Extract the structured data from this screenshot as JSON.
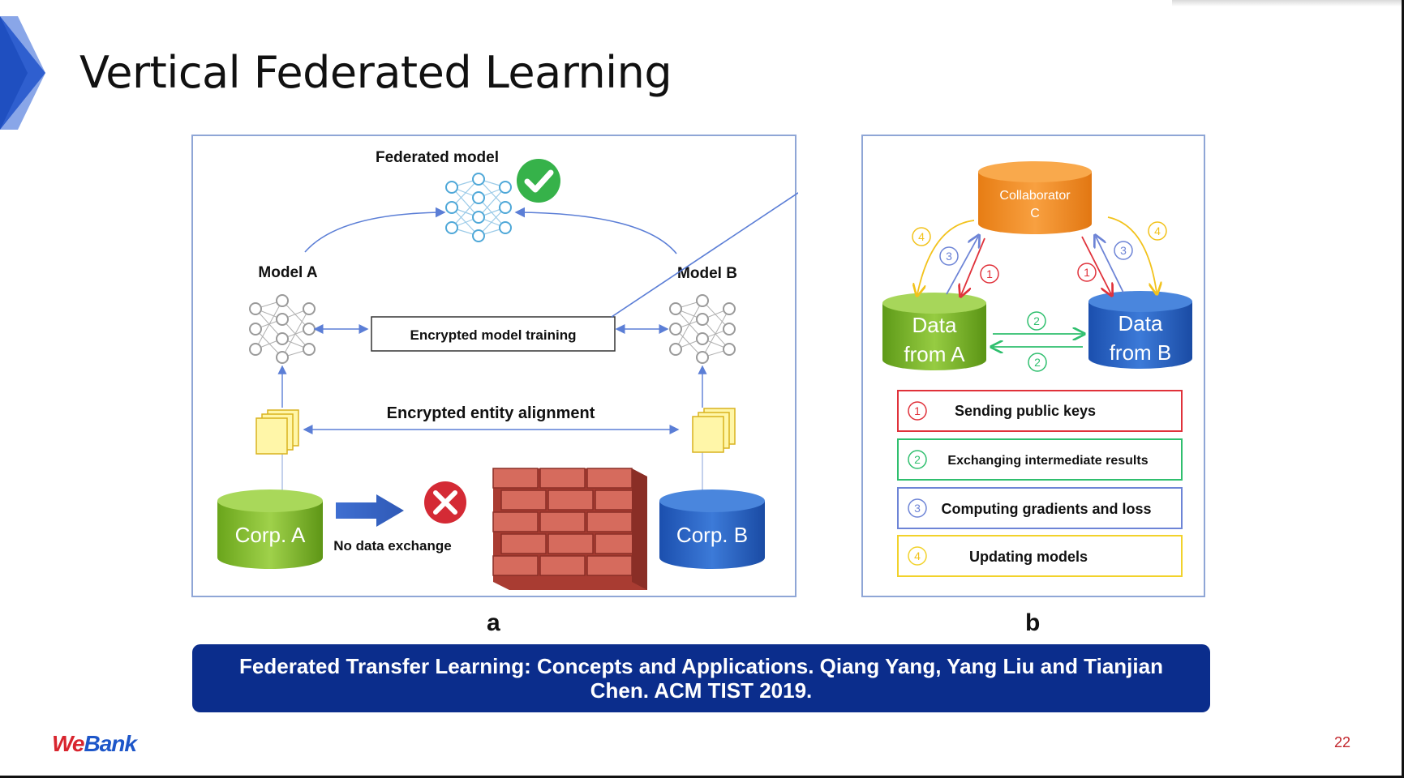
{
  "slide": {
    "title": "Vertical Federated Learning",
    "page_number": "22",
    "brand_prefix": "We",
    "brand_suffix": "Bank",
    "citation": "Federated Transfer Learning: Concepts and Applications.  Qiang Yang, Yang Liu and Tianjian Chen.  ACM TIST 2019."
  },
  "panel_a": {
    "letter": "a",
    "federated_model": "Federated model",
    "model_a": "Model A",
    "model_b": "Model B",
    "encrypted_training": "Encrypted model training",
    "encrypted_alignment": "Encrypted entity alignment",
    "corp_a": "Corp. A",
    "corp_b": "Corp. B",
    "no_data_exchange": "No data exchange"
  },
  "panel_b": {
    "letter": "b",
    "collaborator_line1": "Collaborator",
    "collaborator_line2": "C",
    "data_a_line1": "Data",
    "data_a_line2": "from A",
    "data_b_line1": "Data",
    "data_b_line2": "from B",
    "legend": [
      {
        "num": "1",
        "label": "Sending public keys",
        "color": "#e0313a"
      },
      {
        "num": "2",
        "label": "Exchanging intermediate results",
        "color": "#2fbf6e"
      },
      {
        "num": "3",
        "label": "Computing gradients and loss",
        "color": "#6d84d6"
      },
      {
        "num": "4",
        "label": "Updating models",
        "color": "#f2d22b"
      }
    ]
  },
  "colors": {
    "title_blue": "#0b2d8c",
    "chevron_blue": "#1f4fc0",
    "green": "#7dbb2a",
    "blue": "#2563c7",
    "orange": "#f28c28",
    "brand_red": "#d8252e"
  }
}
